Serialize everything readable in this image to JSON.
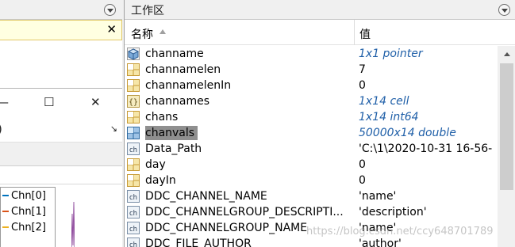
{
  "left_pane": {
    "note_close_label": "✕",
    "figure": {
      "minimize_label": "—",
      "maximize_label": "☐",
      "close_label": "✕",
      "toolbar_partial_label": ")",
      "toolbar_arrow_label": "↘",
      "legend": [
        {
          "label": "Chn[0]",
          "color": "#0072bd"
        },
        {
          "label": "Chn[1]",
          "color": "#d95319"
        },
        {
          "label": "Chn[2]",
          "color": "#edb120"
        }
      ]
    }
  },
  "workspace": {
    "title": "工作区",
    "columns": {
      "name": "名称",
      "value": "值"
    },
    "rows": [
      {
        "icon": "pointer-icon",
        "name": "channame",
        "value": "1x1 pointer",
        "italic": true
      },
      {
        "icon": "numeric-icon",
        "name": "channamelen",
        "value": "7",
        "italic": false
      },
      {
        "icon": "numeric-icon",
        "name": "channamelenIn",
        "value": "0",
        "italic": false
      },
      {
        "icon": "cell-icon",
        "name": "channames",
        "value": "1x14 cell",
        "italic": true
      },
      {
        "icon": "numeric-icon",
        "name": "chans",
        "value": "1x14 int64",
        "italic": true
      },
      {
        "icon": "matrix-icon",
        "name": "chanvals",
        "value": "50000x14 double",
        "italic": true,
        "selected": true
      },
      {
        "icon": "char-icon",
        "name": "Data_Path",
        "value": "'C:\\1\\2020-10-31 16-56-",
        "italic": false
      },
      {
        "icon": "numeric-icon",
        "name": "day",
        "value": "0",
        "italic": false
      },
      {
        "icon": "numeric-icon",
        "name": "dayIn",
        "value": "0",
        "italic": false
      },
      {
        "icon": "char-icon",
        "name": "DDC_CHANNEL_NAME",
        "value": "'name'",
        "italic": false
      },
      {
        "icon": "char-icon",
        "name": "DDC_CHANNELGROUP_DESCRIPTI...",
        "value": "'description'",
        "italic": false
      },
      {
        "icon": "char-icon",
        "name": "DDC_CHANNELGROUP_NAME",
        "value": "'name'",
        "italic": false
      },
      {
        "icon": "char-icon",
        "name": "DDC_FILE_AUTHOR",
        "value": "'author'",
        "italic": false
      }
    ]
  },
  "watermark": "https://blog.csdn.net/ccy648701789"
}
